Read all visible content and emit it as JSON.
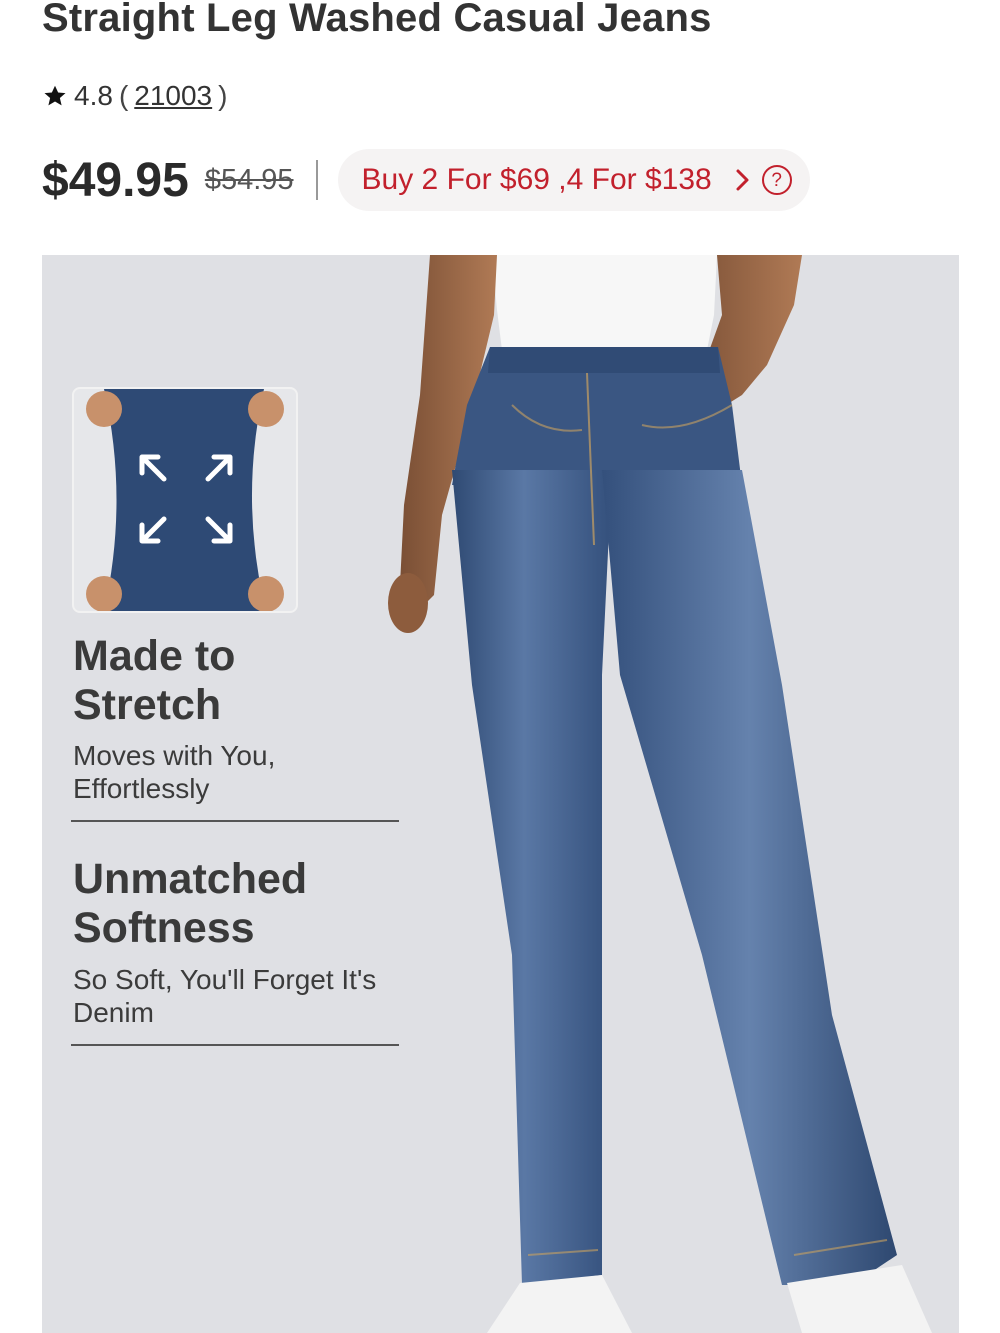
{
  "product": {
    "title": "Straight Leg Washed Casual Jeans",
    "rating": {
      "score": "4.8",
      "open_paren": "(",
      "review_count": "21003",
      "close_paren": ")",
      "icon": "star-icon"
    },
    "price": {
      "current": "$49.95",
      "original": "$54.95"
    },
    "promo": {
      "label": "Buy 2 For $69 ,4 For $138",
      "help_glyph": "?",
      "color": "#c2202c",
      "icons": [
        "chevron-right-icon",
        "help-circle-icon"
      ]
    }
  },
  "hero": {
    "background_color": "#dfe0e4",
    "features": [
      {
        "title_lines": [
          "Made to",
          "Stretch"
        ],
        "desc_lines": [
          "Moves with You,",
          "Effortlessly"
        ]
      },
      {
        "title_lines": [
          "Unmatched",
          "Softness"
        ],
        "desc_lines": [
          "So Soft, You'll Forget It's",
          "Denim"
        ]
      }
    ],
    "thumbnail_icons": [
      "arrow-up-left-icon",
      "arrow-up-right-icon",
      "arrow-down-left-icon",
      "arrow-down-right-icon"
    ],
    "denim_color": "#3d5a86"
  }
}
